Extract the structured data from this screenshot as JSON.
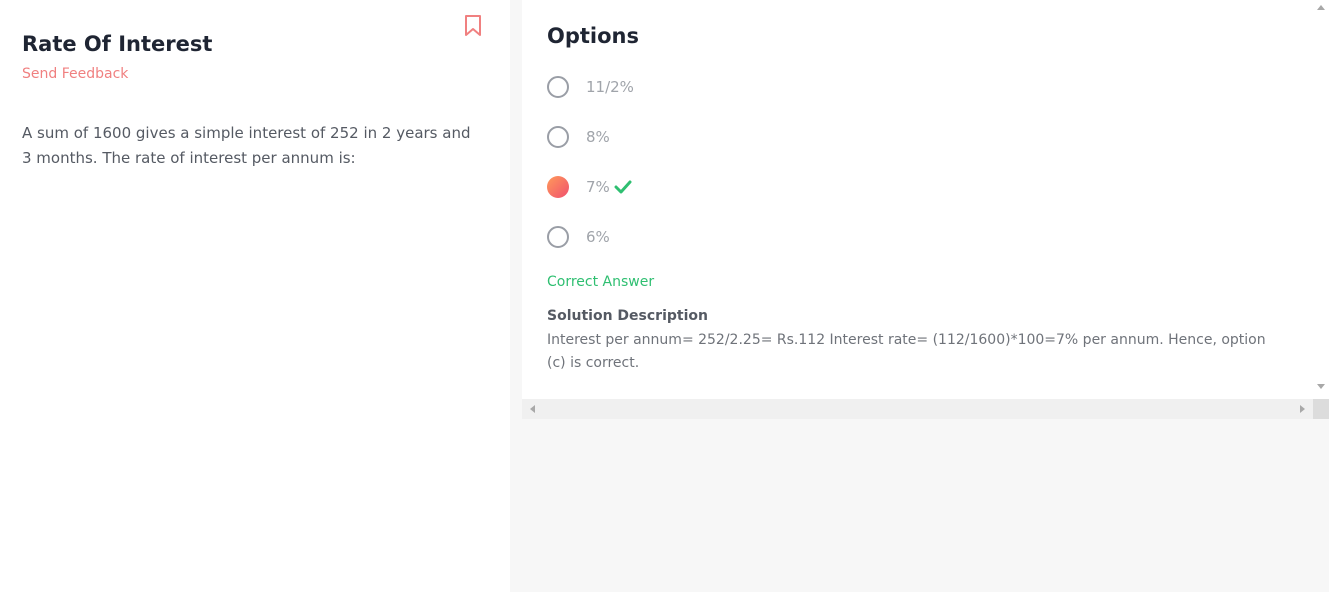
{
  "question": {
    "title": "Rate Of Interest",
    "feedback_label": "Send Feedback",
    "bookmark_icon": "bookmark-icon",
    "text": "A sum of 1600 gives a simple interest of 252 in 2 years and 3 months. The rate of interest per annum is:"
  },
  "options": {
    "heading": "Options",
    "items": [
      {
        "label": "11/2%",
        "selected": false
      },
      {
        "label": "8%",
        "selected": false
      },
      {
        "label": "7%",
        "selected": true,
        "correct": true
      },
      {
        "label": "6%",
        "selected": false
      }
    ],
    "correct_label": "Correct Answer",
    "solution_title": "Solution Description",
    "solution_text": "Interest per annum= 252/2.25= Rs.112 Interest rate= (112/1600)*100=7% per annum. Hence, option (c) is correct."
  },
  "colors": {
    "accent": "#f08080",
    "correct": "#2fbf71",
    "heading": "#1f2533"
  }
}
